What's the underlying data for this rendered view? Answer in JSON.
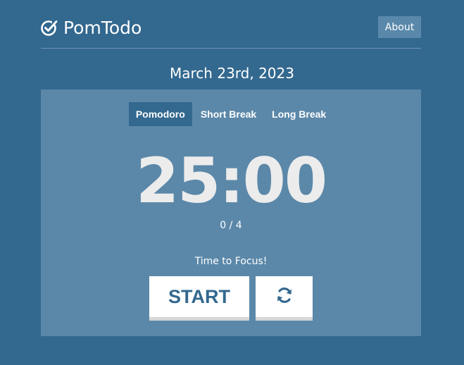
{
  "app": {
    "name": "PomTodo",
    "logo_icon": "check-circle-icon"
  },
  "nav": {
    "about_label": "About"
  },
  "date": "March 23rd, 2023",
  "tabs": [
    {
      "label": "Pomodoro",
      "active": true
    },
    {
      "label": "Short Break",
      "active": false
    },
    {
      "label": "Long Break",
      "active": false
    }
  ],
  "timer": {
    "display": "25:00",
    "count": "0 / 4",
    "message": "Time to Focus!"
  },
  "controls": {
    "start_label": "START",
    "reset_icon": "sync-icon"
  },
  "colors": {
    "background": "#33688f",
    "panel": "#5b88a9",
    "active_tab": "#33688f",
    "button_text": "#33688f"
  }
}
